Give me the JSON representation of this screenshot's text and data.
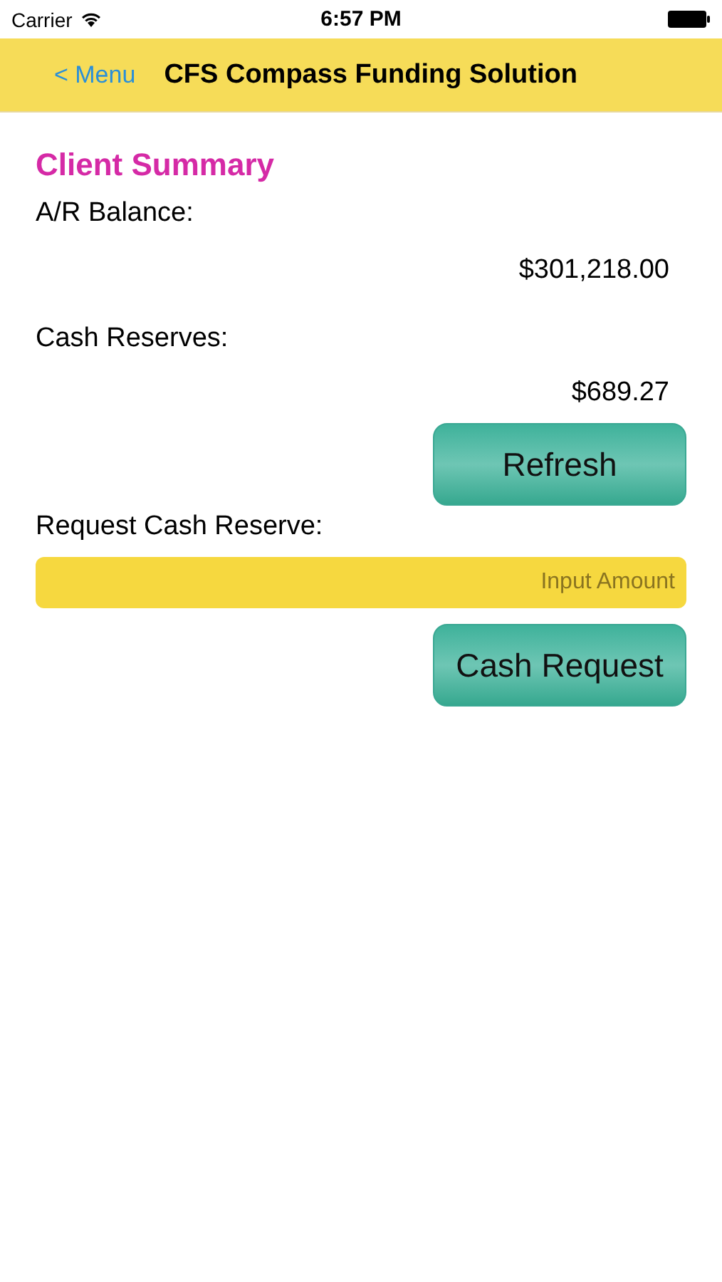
{
  "status_bar": {
    "carrier": "Carrier",
    "time": "6:57 PM"
  },
  "nav_bar": {
    "back": "< Menu",
    "title": "CFS Compass Funding Solution"
  },
  "section_title": "Client Summary",
  "ar_balance": {
    "label": "A/R Balance:",
    "value": "$301,218.00"
  },
  "cash_reserves": {
    "label": "Cash Reserves:",
    "value": "$689.27"
  },
  "refresh_button": "Refresh",
  "request": {
    "label": "Request Cash Reserve:",
    "placeholder": "Input Amount",
    "button": "Cash Request"
  }
}
